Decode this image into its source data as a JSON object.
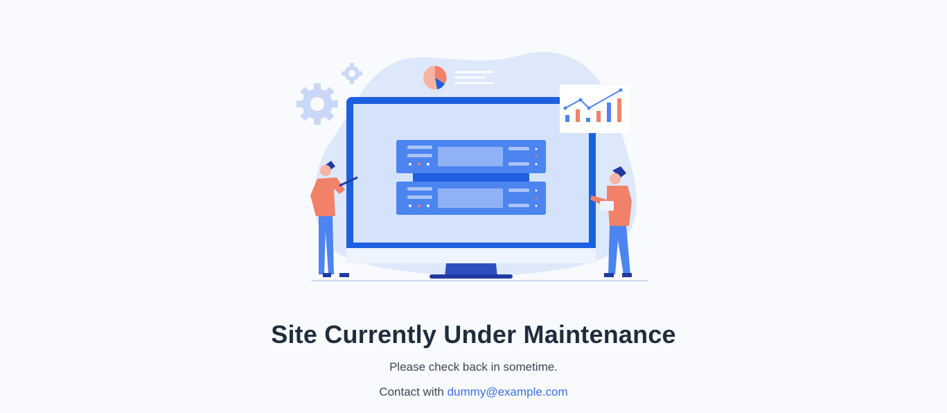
{
  "maintenance": {
    "title": "Site Currently Under Maintenance",
    "subtitle": "Please check back in sometime.",
    "contact_prefix": "Contact with",
    "contact_email": "dummy@example.com"
  },
  "illustration": {
    "icons": [
      "gear-icon",
      "pie-chart-icon",
      "line-bar-chart-icon",
      "server-rack-icon",
      "monitor-icon"
    ]
  },
  "colors": {
    "background": "#f9fafd",
    "title": "#1f2d3d",
    "text": "#3d4650",
    "link": "#3a6fe0",
    "accent_blue": "#1e5fe0",
    "accent_orange": "#f2816a"
  }
}
